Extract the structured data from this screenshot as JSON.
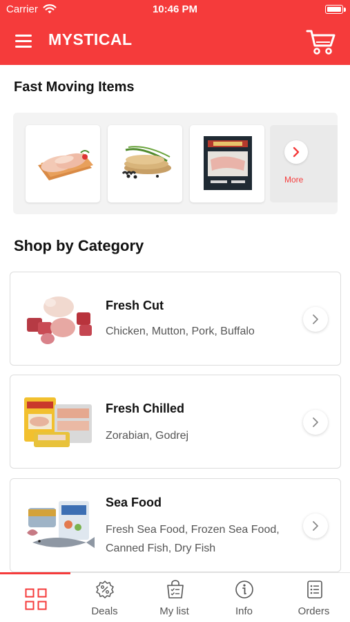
{
  "status_bar": {
    "carrier": "Carrier",
    "time": "10:46 PM"
  },
  "header": {
    "title": "MYSTICAL",
    "menu_icon": "hamburger-menu-icon",
    "cart_icon": "shopping-cart-icon"
  },
  "fast_moving": {
    "title": "Fast Moving Items",
    "items": [
      {
        "image": "raw-chicken-breast"
      },
      {
        "image": "rolled-wraps-with-scallion"
      },
      {
        "image": "packaged-sliced-meat"
      }
    ],
    "more_label": "More",
    "more_icon": "chevron-right-icon"
  },
  "categories": {
    "title": "Shop by Category",
    "items": [
      {
        "name": "Fresh Cut",
        "description": "Chicken, Mutton, Pork, Buffalo",
        "image": "raw-meat-cuts",
        "arrow_icon": "chevron-right-icon"
      },
      {
        "name": "Fresh Chilled",
        "description": "Zorabian, Godrej",
        "image": "chilled-meat-packs",
        "arrow_icon": "chevron-right-icon"
      },
      {
        "name": "Sea Food",
        "description": "Fresh Sea Food, Frozen Sea Food, Canned Fish, Dry Fish",
        "image": "seafood-assortment",
        "arrow_icon": "chevron-right-icon"
      }
    ]
  },
  "tab_bar": {
    "active_index": 0,
    "tabs": [
      {
        "label": "",
        "icon": "grid-icon"
      },
      {
        "label": "Deals",
        "icon": "discount-badge-icon"
      },
      {
        "label": "My list",
        "icon": "shopping-bag-list-icon"
      },
      {
        "label": "Info",
        "icon": "info-icon"
      },
      {
        "label": "Orders",
        "icon": "orders-list-icon"
      }
    ]
  },
  "colors": {
    "brand": "#f53b3b",
    "text": "#111111",
    "muted": "#555555",
    "card_border": "#dcdcdc"
  }
}
